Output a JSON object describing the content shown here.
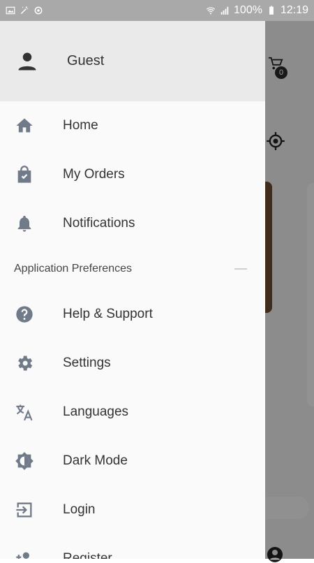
{
  "status_bar": {
    "battery": "100%",
    "time": "12:19",
    "icons": [
      "gallery-icon",
      "magic-wand-icon",
      "sync-icon",
      "wifi-icon",
      "signal-icon",
      "battery-icon"
    ]
  },
  "drawer": {
    "header": {
      "user_name": "Guest",
      "avatar_icon": "person-icon"
    },
    "items": [
      {
        "label": "Home",
        "icon": "home-icon"
      },
      {
        "label": "My Orders",
        "icon": "shopping-bag-icon"
      },
      {
        "label": "Notifications",
        "icon": "bell-icon"
      }
    ],
    "section": {
      "title": "Application Preferences"
    },
    "preferences": [
      {
        "label": "Help & Support",
        "icon": "help-icon"
      },
      {
        "label": "Settings",
        "icon": "gear-icon"
      },
      {
        "label": "Languages",
        "icon": "translate-icon"
      },
      {
        "label": "Dark Mode",
        "icon": "brightness-icon"
      },
      {
        "label": "Login",
        "icon": "login-icon"
      },
      {
        "label": "Register",
        "icon": "add-person-icon"
      }
    ]
  },
  "background": {
    "cart_count": "0"
  },
  "colors": {
    "icon": "#707a88",
    "text": "#333333",
    "header_bg": "#eaeaea",
    "drawer_bg": "#fafafa",
    "status_bar": "#a9a9a9"
  }
}
